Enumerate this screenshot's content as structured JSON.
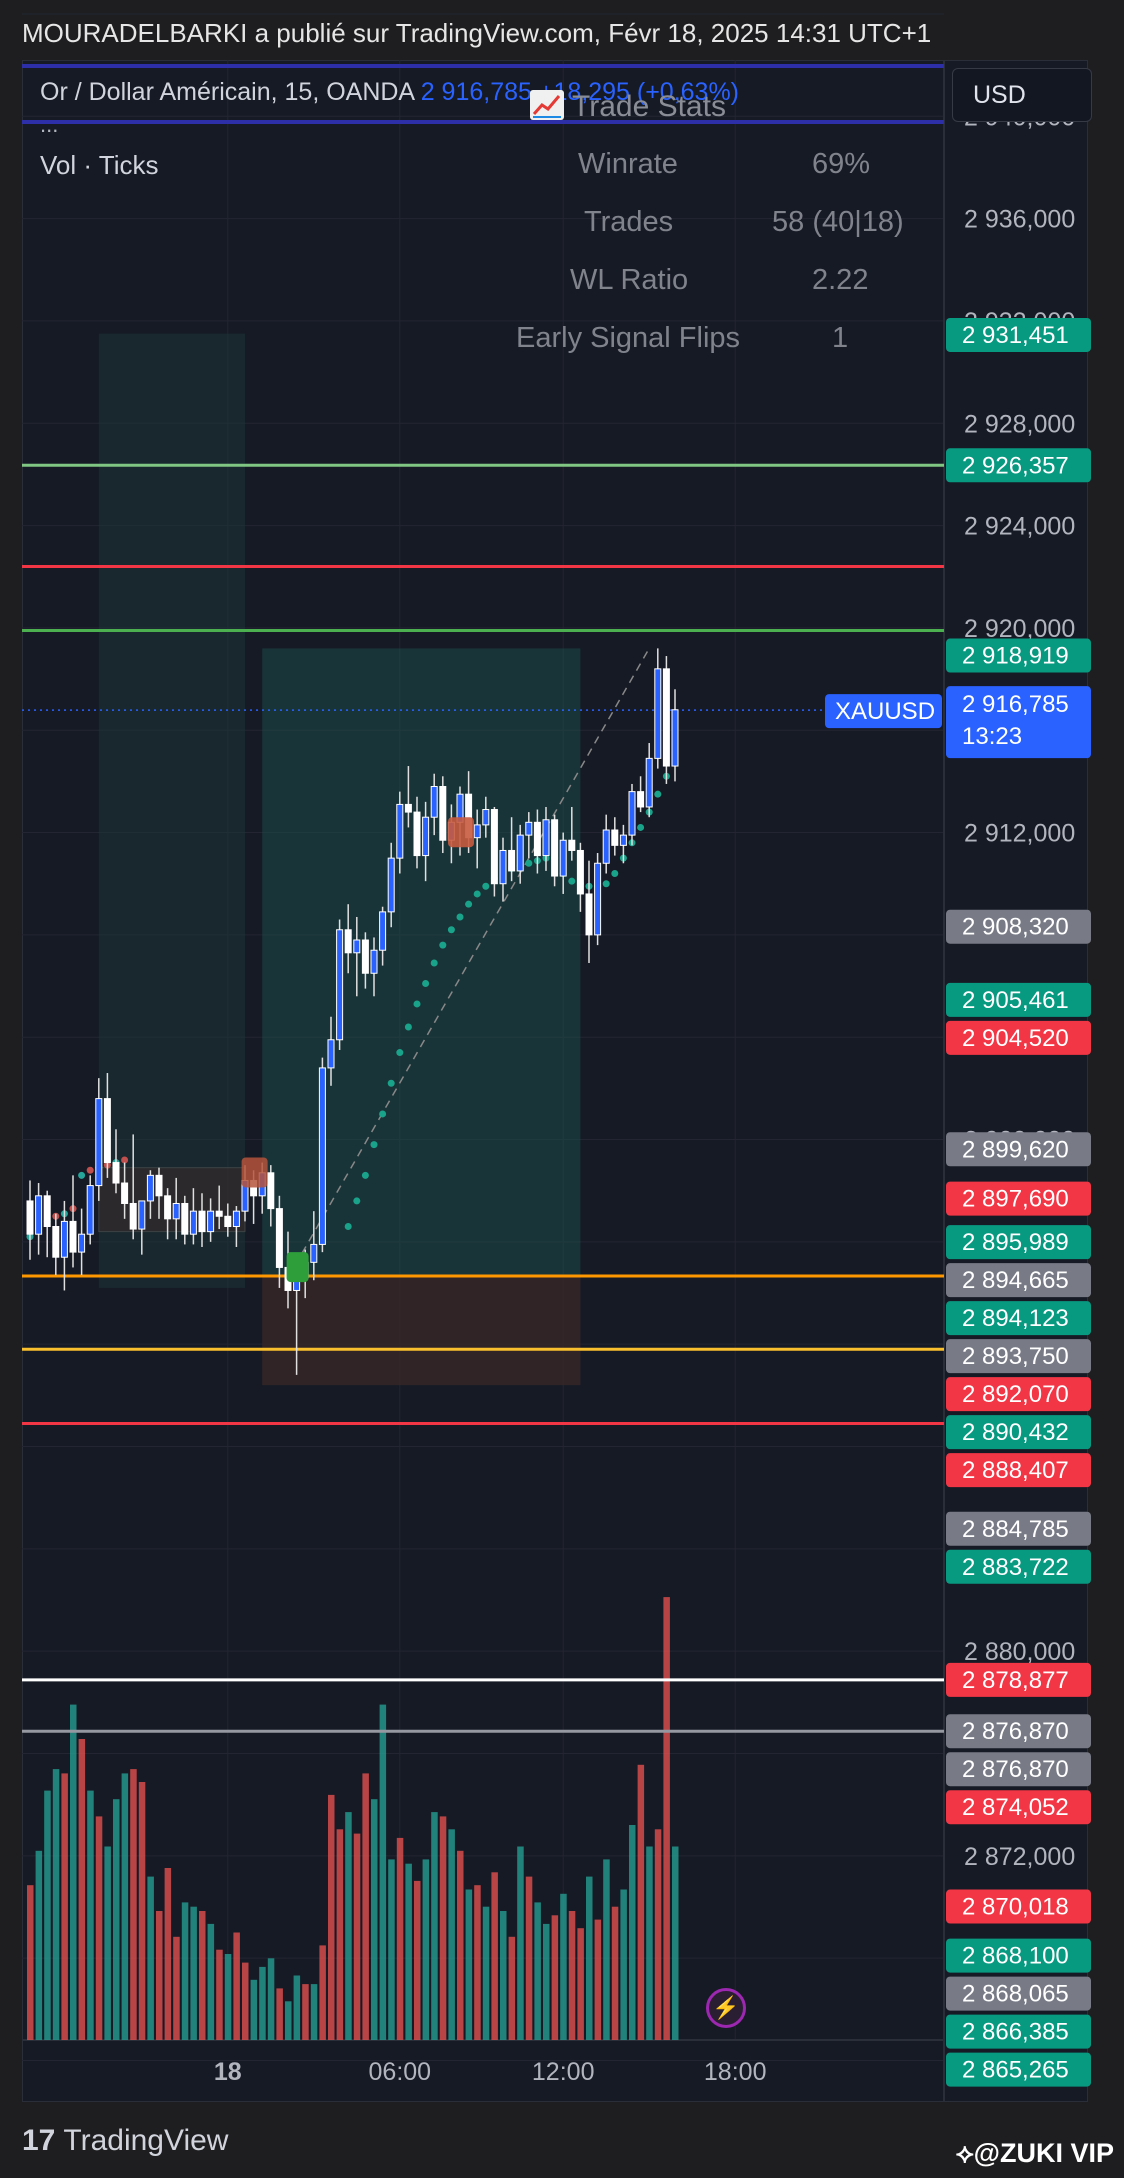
{
  "published_line": "MOURADELBARKI a publié sur TradingView.com, Févr 18, 2025 14:31 UTC+1",
  "symbol_line": {
    "name": "Or / Dollar Américain, 15, OANDA",
    "price": "2 916,785",
    "change": "+18,295 (+0,63%)"
  },
  "more_indicator": "...",
  "volume_indicator": "Vol · Ticks",
  "currency_button": "USD",
  "trade_stats": {
    "title": "Trade Stats",
    "icon": "chart-increasing-icon",
    "rows": [
      {
        "label": "Winrate",
        "value": "69%"
      },
      {
        "label": "Trades",
        "value": "58 (40|18)"
      },
      {
        "label": "WL Ratio",
        "value": "2.22"
      },
      {
        "label": "Early Signal Flips",
        "value": "1"
      }
    ]
  },
  "colors": {
    "bull_candle": "#2962ff",
    "bear_candle": "#ffffff",
    "vol_green": "#26a69a",
    "vol_red": "#ef5350",
    "tag_green": "#089981",
    "tag_red": "#f23645",
    "tag_gray": "#787b86",
    "tag_blue": "#2962ff"
  },
  "chart_data": {
    "type": "candlestick",
    "symbol": "XAUUSD",
    "interval": "15",
    "x_ticks": [
      {
        "label": "18",
        "bar": 23
      },
      {
        "label": "06:00",
        "bar": 43
      },
      {
        "label": "12:00",
        "bar": 62
      },
      {
        "label": "18:00",
        "bar": 82
      }
    ],
    "y_ticks": [
      "2 940,000",
      "2 936,000",
      "2 932,000",
      "2 928,000",
      "2 924,000",
      "2 920,000",
      "2 912,000",
      "2 900,000",
      "2 880,000",
      "2 872,000"
    ],
    "ylim": [
      2864.8,
      2942.2
    ],
    "current_price": {
      "symbol": "XAUUSD",
      "value": "2 916,785",
      "countdown": "13:23"
    },
    "price_tags": [
      {
        "value": "2 931,451",
        "color": "green"
      },
      {
        "value": "2 926,357",
        "color": "green"
      },
      {
        "value": "2 918,919",
        "color": "green"
      },
      {
        "value": "2 908,320",
        "color": "gray"
      },
      {
        "value": "2 905,461",
        "color": "green"
      },
      {
        "value": "2 904,520",
        "color": "red"
      },
      {
        "value": "2 899,620",
        "color": "gray"
      },
      {
        "value": "2 897,690",
        "color": "red"
      },
      {
        "value": "2 895,989",
        "color": "green"
      },
      {
        "value": "2 894,665",
        "color": "gray"
      },
      {
        "value": "2 894,123",
        "color": "green"
      },
      {
        "value": "2 893,750",
        "color": "gray"
      },
      {
        "value": "2 892,070",
        "color": "red"
      },
      {
        "value": "2 890,432",
        "color": "green"
      },
      {
        "value": "2 888,407",
        "color": "red"
      },
      {
        "value": "2 884,785",
        "color": "gray"
      },
      {
        "value": "2 883,722",
        "color": "green"
      },
      {
        "value": "2 878,877",
        "color": "red"
      },
      {
        "value": "2 876,870",
        "color": "gray"
      },
      {
        "value": "2 876,870",
        "color": "gray"
      },
      {
        "value": "2 874,052",
        "color": "red"
      },
      {
        "value": "2 870,018",
        "color": "red"
      },
      {
        "value": "2 868,100",
        "color": "green"
      },
      {
        "value": "2 868,065",
        "color": "gray"
      },
      {
        "value": "2 866,385",
        "color": "green"
      },
      {
        "value": "2 865,265",
        "color": "green"
      }
    ],
    "horizontal_lines": [
      {
        "price": 2926.357,
        "color": "#81c784"
      },
      {
        "price": 2922.4,
        "color": "#f23645"
      },
      {
        "price": 2919.9,
        "color": "#4caf50"
      },
      {
        "price": 2894.665,
        "color": "#ff9800"
      },
      {
        "price": 2891.8,
        "color": "#fbc02d"
      },
      {
        "price": 2888.9,
        "color": "#f23645"
      },
      {
        "price": 2878.877,
        "color": "#ffffff"
      },
      {
        "price": 2876.87,
        "color": "#9598a1"
      }
    ],
    "candles": [
      [
        2897.6,
        2898.4,
        2895.3,
        2896.3
      ],
      [
        2896.3,
        2898.3,
        2895.5,
        2897.8
      ],
      [
        2897.8,
        2898.0,
        2895.4,
        2896.6
      ],
      [
        2896.6,
        2897.1,
        2894.7,
        2895.4
      ],
      [
        2895.4,
        2897.6,
        2894.1,
        2896.8
      ],
      [
        2896.8,
        2898.6,
        2895.0,
        2895.6
      ],
      [
        2895.6,
        2897.3,
        2894.7,
        2896.3
      ],
      [
        2896.3,
        2898.6,
        2895.9,
        2898.2
      ],
      [
        2898.2,
        2902.4,
        2897.6,
        2901.6
      ],
      [
        2901.6,
        2902.6,
        2898.5,
        2899.1
      ],
      [
        2899.1,
        2900.4,
        2897.9,
        2898.3
      ],
      [
        2898.3,
        2899.1,
        2896.9,
        2897.5
      ],
      [
        2897.5,
        2900.2,
        2896.1,
        2896.5
      ],
      [
        2896.5,
        2897.1,
        2895.5,
        2897.6
      ],
      [
        2897.6,
        2898.8,
        2896.9,
        2898.6
      ],
      [
        2898.6,
        2898.9,
        2896.9,
        2897.8
      ],
      [
        2897.8,
        2898.1,
        2896.1,
        2896.9
      ],
      [
        2896.9,
        2898.5,
        2896.1,
        2897.5
      ],
      [
        2897.5,
        2897.8,
        2895.9,
        2896.3
      ],
      [
        2896.3,
        2898.1,
        2895.9,
        2897.2
      ],
      [
        2897.2,
        2897.9,
        2895.8,
        2896.4
      ],
      [
        2896.4,
        2897.7,
        2896.0,
        2897.2
      ],
      [
        2897.2,
        2898.2,
        2896.5,
        2897.0
      ],
      [
        2897.0,
        2897.5,
        2896.2,
        2896.6
      ],
      [
        2896.6,
        2897.4,
        2895.8,
        2897.2
      ],
      [
        2897.2,
        2899.0,
        2896.8,
        2898.4
      ],
      [
        2898.4,
        2898.8,
        2896.7,
        2897.8
      ],
      [
        2897.8,
        2899.1,
        2897.1,
        2898.7
      ],
      [
        2898.7,
        2899.0,
        2896.6,
        2897.3
      ],
      [
        2897.3,
        2897.8,
        2894.2,
        2895.0
      ],
      [
        2895.0,
        2896.4,
        2893.4,
        2894.1
      ],
      [
        2894.1,
        2895.1,
        2890.8,
        2894.6
      ],
      [
        2894.6,
        2895.7,
        2893.8,
        2895.2
      ],
      [
        2895.2,
        2897.2,
        2894.5,
        2895.9
      ],
      [
        2895.9,
        2903.2,
        2895.6,
        2902.8
      ],
      [
        2902.8,
        2904.8,
        2902.1,
        2903.9
      ],
      [
        2903.9,
        2908.6,
        2903.5,
        2908.2
      ],
      [
        2908.2,
        2909.2,
        2906.5,
        2907.3
      ],
      [
        2907.3,
        2908.7,
        2905.6,
        2907.8
      ],
      [
        2907.8,
        2908.1,
        2905.9,
        2906.5
      ],
      [
        2906.5,
        2907.9,
        2905.6,
        2907.4
      ],
      [
        2907.4,
        2909.1,
        2906.8,
        2908.9
      ],
      [
        2908.9,
        2911.6,
        2908.3,
        2911.0
      ],
      [
        2911.0,
        2913.6,
        2910.4,
        2913.1
      ],
      [
        2913.1,
        2914.6,
        2912.2,
        2912.8
      ],
      [
        2912.8,
        2913.4,
        2910.6,
        2911.1
      ],
      [
        2911.1,
        2913.2,
        2910.1,
        2912.6
      ],
      [
        2912.6,
        2914.3,
        2911.9,
        2913.8
      ],
      [
        2913.8,
        2914.2,
        2911.2,
        2911.7
      ],
      [
        2911.7,
        2913.1,
        2910.8,
        2912.4
      ],
      [
        2912.4,
        2913.8,
        2911.1,
        2913.5
      ],
      [
        2913.5,
        2914.4,
        2911.2,
        2911.8
      ],
      [
        2911.8,
        2912.9,
        2910.6,
        2912.3
      ],
      [
        2912.3,
        2913.4,
        2911.8,
        2912.9
      ],
      [
        2912.9,
        2913.0,
        2909.5,
        2910.0
      ],
      [
        2910.0,
        2911.8,
        2909.3,
        2911.3
      ],
      [
        2911.3,
        2912.6,
        2910.1,
        2910.5
      ],
      [
        2910.5,
        2912.3,
        2910.0,
        2911.9
      ],
      [
        2911.9,
        2912.8,
        2911.0,
        2912.4
      ],
      [
        2912.4,
        2912.9,
        2910.4,
        2911.1
      ],
      [
        2911.1,
        2913.0,
        2910.5,
        2912.5
      ],
      [
        2912.5,
        2912.7,
        2909.9,
        2910.3
      ],
      [
        2910.3,
        2912.0,
        2909.6,
        2911.7
      ],
      [
        2911.7,
        2913.0,
        2910.9,
        2911.3
      ],
      [
        2911.3,
        2911.6,
        2908.9,
        2909.6
      ],
      [
        2909.6,
        2910.9,
        2906.9,
        2908.0
      ],
      [
        2908.0,
        2911.2,
        2907.6,
        2910.8
      ],
      [
        2910.8,
        2912.7,
        2910.4,
        2912.1
      ],
      [
        2912.1,
        2912.6,
        2911.1,
        2911.5
      ],
      [
        2911.5,
        2912.3,
        2910.8,
        2911.9
      ],
      [
        2911.9,
        2913.9,
        2911.5,
        2913.6
      ],
      [
        2913.6,
        2914.2,
        2912.8,
        2913.0
      ],
      [
        2913.0,
        2915.5,
        2912.6,
        2914.9
      ],
      [
        2914.9,
        2919.2,
        2914.5,
        2918.4
      ],
      [
        2918.4,
        2918.9,
        2913.9,
        2914.6
      ],
      [
        2914.6,
        2917.6,
        2914.0,
        2916.8
      ]
    ],
    "volume": [
      {
        "v": 0.36,
        "c": "red"
      },
      {
        "v": 0.44,
        "c": "green"
      },
      {
        "v": 0.58,
        "c": "green"
      },
      {
        "v": 0.63,
        "c": "green"
      },
      {
        "v": 0.62,
        "c": "red"
      },
      {
        "v": 0.78,
        "c": "green"
      },
      {
        "v": 0.7,
        "c": "red"
      },
      {
        "v": 0.58,
        "c": "green"
      },
      {
        "v": 0.52,
        "c": "red"
      },
      {
        "v": 0.45,
        "c": "green"
      },
      {
        "v": 0.56,
        "c": "green"
      },
      {
        "v": 0.62,
        "c": "green"
      },
      {
        "v": 0.63,
        "c": "red"
      },
      {
        "v": 0.6,
        "c": "red"
      },
      {
        "v": 0.38,
        "c": "green"
      },
      {
        "v": 0.3,
        "c": "red"
      },
      {
        "v": 0.4,
        "c": "red"
      },
      {
        "v": 0.24,
        "c": "red"
      },
      {
        "v": 0.32,
        "c": "green"
      },
      {
        "v": 0.31,
        "c": "green"
      },
      {
        "v": 0.3,
        "c": "red"
      },
      {
        "v": 0.27,
        "c": "green"
      },
      {
        "v": 0.21,
        "c": "red"
      },
      {
        "v": 0.2,
        "c": "green"
      },
      {
        "v": 0.25,
        "c": "red"
      },
      {
        "v": 0.18,
        "c": "red"
      },
      {
        "v": 0.14,
        "c": "green"
      },
      {
        "v": 0.17,
        "c": "green"
      },
      {
        "v": 0.19,
        "c": "green"
      },
      {
        "v": 0.12,
        "c": "red"
      },
      {
        "v": 0.09,
        "c": "green"
      },
      {
        "v": 0.15,
        "c": "green"
      },
      {
        "v": 0.13,
        "c": "red"
      },
      {
        "v": 0.13,
        "c": "green"
      },
      {
        "v": 0.22,
        "c": "red"
      },
      {
        "v": 0.57,
        "c": "red"
      },
      {
        "v": 0.49,
        "c": "red"
      },
      {
        "v": 0.53,
        "c": "green"
      },
      {
        "v": 0.48,
        "c": "red"
      },
      {
        "v": 0.62,
        "c": "red"
      },
      {
        "v": 0.56,
        "c": "green"
      },
      {
        "v": 0.78,
        "c": "green"
      },
      {
        "v": 0.42,
        "c": "green"
      },
      {
        "v": 0.47,
        "c": "red"
      },
      {
        "v": 0.41,
        "c": "green"
      },
      {
        "v": 0.37,
        "c": "red"
      },
      {
        "v": 0.42,
        "c": "green"
      },
      {
        "v": 0.53,
        "c": "green"
      },
      {
        "v": 0.52,
        "c": "red"
      },
      {
        "v": 0.49,
        "c": "green"
      },
      {
        "v": 0.44,
        "c": "red"
      },
      {
        "v": 0.35,
        "c": "green"
      },
      {
        "v": 0.36,
        "c": "red"
      },
      {
        "v": 0.31,
        "c": "green"
      },
      {
        "v": 0.39,
        "c": "red"
      },
      {
        "v": 0.3,
        "c": "green"
      },
      {
        "v": 0.24,
        "c": "red"
      },
      {
        "v": 0.45,
        "c": "green"
      },
      {
        "v": 0.38,
        "c": "red"
      },
      {
        "v": 0.32,
        "c": "green"
      },
      {
        "v": 0.27,
        "c": "green"
      },
      {
        "v": 0.29,
        "c": "red"
      },
      {
        "v": 0.34,
        "c": "green"
      },
      {
        "v": 0.3,
        "c": "red"
      },
      {
        "v": 0.26,
        "c": "red"
      },
      {
        "v": 0.38,
        "c": "green"
      },
      {
        "v": 0.28,
        "c": "red"
      },
      {
        "v": 0.42,
        "c": "green"
      },
      {
        "v": 0.31,
        "c": "red"
      },
      {
        "v": 0.35,
        "c": "green"
      },
      {
        "v": 0.5,
        "c": "green"
      },
      {
        "v": 0.64,
        "c": "red"
      },
      {
        "v": 0.45,
        "c": "green"
      },
      {
        "v": 0.49,
        "c": "red"
      },
      {
        "v": 1.03,
        "c": "red"
      },
      {
        "v": 0.45,
        "c": "green"
      }
    ],
    "stop_dots": [
      2896.2,
      2896.5,
      2896.8,
      2897.0,
      2897.1,
      2897.3,
      2898.6,
      2898.8,
      2898.9,
      2899.0,
      2899.1,
      2899.2,
      2896.6,
      2897.6,
      2898.6,
      2899.8,
      2901.0,
      2902.2,
      2903.4,
      2904.4,
      2905.3,
      2906.1,
      2906.9,
      2907.6,
      2908.2,
      2908.7,
      2909.2,
      2909.6,
      2909.9,
      2910.2,
      2910.4,
      2910.6,
      2910.7,
      2910.8,
      2910.9,
      2911.0,
      2911.0,
      2910.4,
      2910.1,
      2910.0,
      2909.9,
      2909.9,
      2910.0,
      2910.4,
      2911.0,
      2911.6,
      2912.2,
      2912.8,
      2913.5,
      2914.2
    ]
  }
}
